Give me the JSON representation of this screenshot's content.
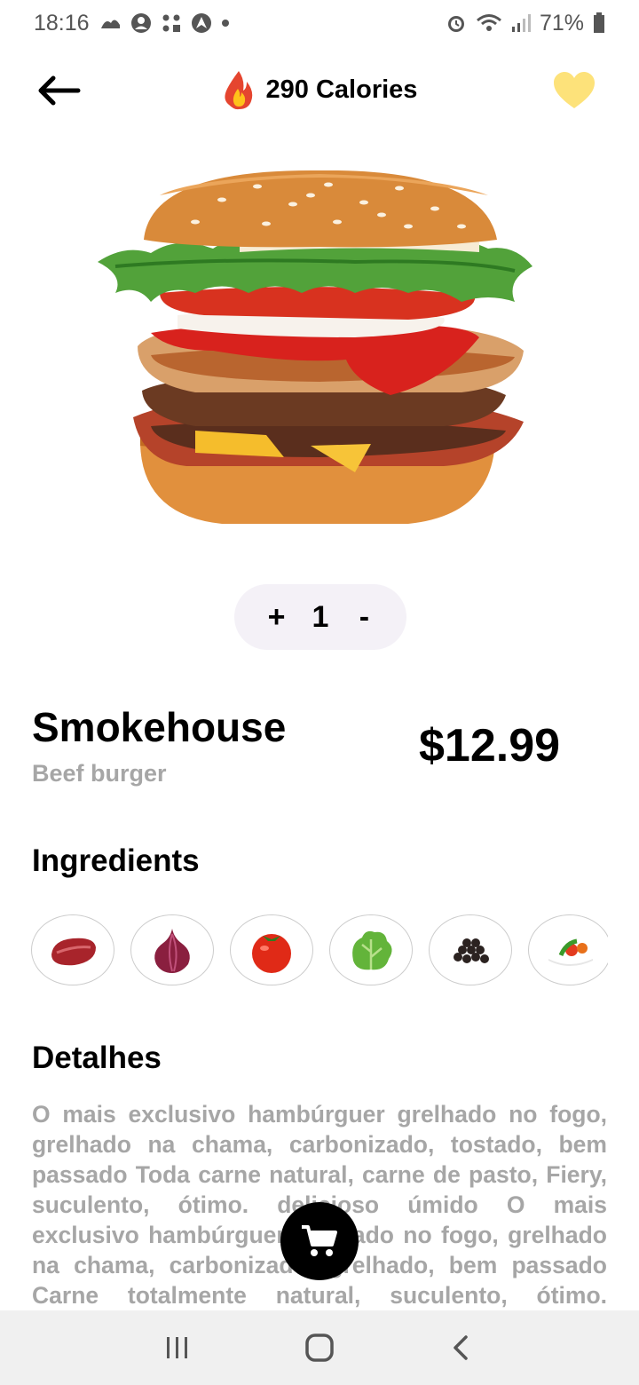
{
  "status_bar": {
    "time": "18:16",
    "battery": "71%",
    "icons_left": [
      "cloud-icon",
      "account-icon",
      "apps-icon",
      "navigation-icon",
      "dot-icon"
    ],
    "icons_right": [
      "alarm-icon",
      "wifi-icon",
      "signal-icon",
      "battery-icon"
    ]
  },
  "header": {
    "calories": "290 Calories",
    "back_icon": "arrow-left-icon",
    "calories_icon": "fire-icon",
    "favorite_icon": "heart-icon",
    "favorite_color": "#fde27a"
  },
  "quantity": {
    "plus": "+",
    "value": "1",
    "minus": "-"
  },
  "product": {
    "name": "Smokehouse",
    "subtitle": "Beef burger",
    "price": "$12.99"
  },
  "ingredients": {
    "title": "Ingredients",
    "items": [
      "beef",
      "onion",
      "tomato",
      "lettuce",
      "pepper",
      "salad"
    ]
  },
  "details": {
    "title": "Detalhes",
    "text": "O mais exclusivo hambúrguer grelhado no fogo, grelhado na chama, carbonizado, tostado, bem passado Toda carne natural, carne de pasto, Fiery, suculento, ótimo. delicioso úmido O mais exclusivo hambúrguer grelhado no fogo, grelhado na chama, carbonizado, grelhado, bem passado Carne totalmente natural, suculento, ótimo. delicioso."
  },
  "cart": {
    "icon": "cart-icon"
  },
  "nav": {
    "icons": [
      "recent-apps-icon",
      "home-icon",
      "back-icon"
    ]
  }
}
